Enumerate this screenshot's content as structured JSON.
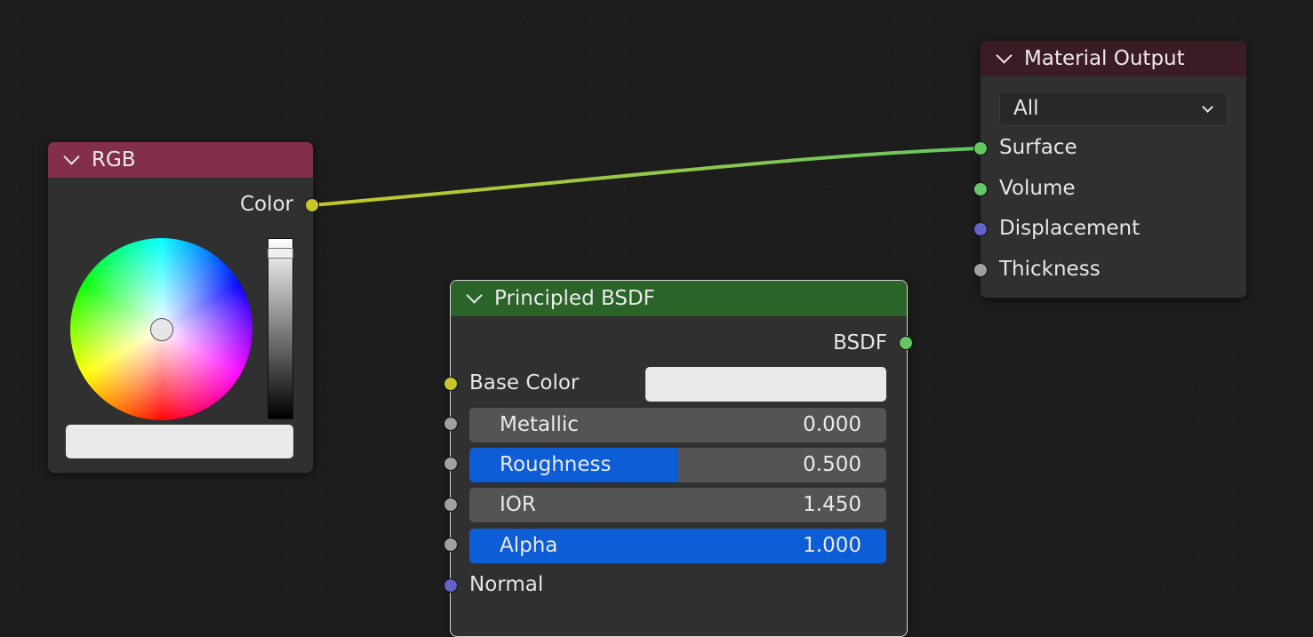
{
  "nodes": {
    "rgb": {
      "title": "RGB",
      "output_label": "Color",
      "header_color": "#842f4a",
      "swatch_color": "#e9e9e9"
    },
    "bsdf": {
      "title": "Principled BSDF",
      "output_label": "BSDF",
      "header_color": "#2b6429",
      "base_color_label": "Base Color",
      "base_color_value": "#e9e9e9",
      "inputs": [
        {
          "label": "Metallic",
          "value": "0.000",
          "fill": 0.0
        },
        {
          "label": "Roughness",
          "value": "0.500",
          "fill": 0.5
        },
        {
          "label": "IOR",
          "value": "1.450",
          "fill": 0.0
        },
        {
          "label": "Alpha",
          "value": "1.000",
          "fill": 1.0
        }
      ],
      "normal_label": "Normal"
    },
    "output": {
      "title": "Material Output",
      "header_color": "#3c1c24",
      "target": "All",
      "inputs": [
        "Surface",
        "Volume",
        "Displacement",
        "Thickness"
      ]
    }
  },
  "socket_colors": {
    "color": "#c7c729",
    "shader": "#63c763",
    "vector": "#6363c7",
    "float": "#a1a1a1"
  },
  "link_color": {
    "from": "#c7c729",
    "to": "#63c763"
  }
}
